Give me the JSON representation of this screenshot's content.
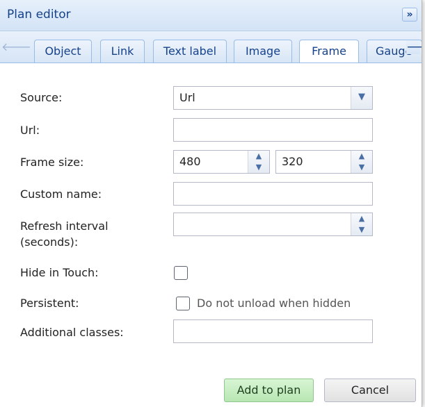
{
  "panel": {
    "title": "Plan editor",
    "collapse_glyph": "»"
  },
  "tabs": [
    {
      "label": "Object"
    },
    {
      "label": "Link"
    },
    {
      "label": "Text label"
    },
    {
      "label": "Image"
    },
    {
      "label": "Frame",
      "active": true
    },
    {
      "label": "Gauge"
    }
  ],
  "form": {
    "source_label": "Source:",
    "source_value": "Url",
    "url_label": "Url:",
    "url_value": "",
    "frame_size_label": "Frame size:",
    "frame_width": "480",
    "frame_height": "320",
    "custom_name_label": "Custom name:",
    "custom_name_value": "",
    "refresh_label_line1": "Refresh interval",
    "refresh_label_line2": "(seconds):",
    "refresh_value": "",
    "hide_touch_label": "Hide in Touch:",
    "hide_touch_checked": false,
    "persistent_label": "Persistent:",
    "persistent_checkbox_text": "Do not unload when hidden",
    "persistent_checked": false,
    "additional_classes_label": "Additional classes:",
    "additional_classes_value": ""
  },
  "buttons": {
    "add": "Add to plan",
    "cancel": "Cancel"
  },
  "icons": {
    "scroll_left": "arrow-left-icon",
    "scroll_right": "arrow-right-icon",
    "dropdown": "chevron-down-icon",
    "spinner": "spinner-arrows-icon",
    "collapse": "double-chevron-right-icon"
  }
}
